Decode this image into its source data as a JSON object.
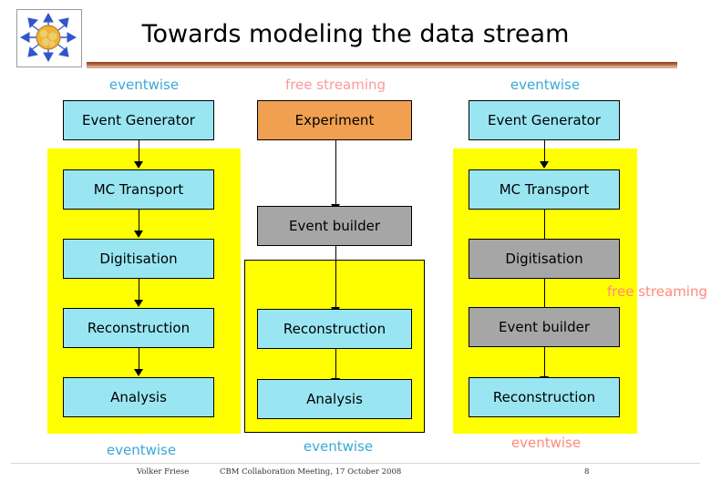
{
  "slide": {
    "title": "Towards modeling the data stream",
    "logo_name": "cbm-logo"
  },
  "column_captions": {
    "top_left": "eventwise",
    "top_mid": "free streaming",
    "top_right": "eventwise",
    "bottom_left": "eventwise",
    "bottom_mid": "eventwise",
    "bottom_right": "eventwise",
    "right_mid_label": "free streaming"
  },
  "boxes": {
    "left": [
      {
        "label": "Event Generator",
        "style": "cyan"
      },
      {
        "label": "MC Transport",
        "style": "cyan"
      },
      {
        "label": "Digitisation",
        "style": "cyan"
      },
      {
        "label": "Reconstruction",
        "style": "cyan"
      },
      {
        "label": "Analysis",
        "style": "cyan"
      }
    ],
    "middle": [
      {
        "label": "Experiment",
        "style": "orange"
      },
      {
        "label": "Event builder",
        "style": "grey"
      },
      {
        "label": "Reconstruction",
        "style": "cyan"
      },
      {
        "label": "Analysis",
        "style": "cyan"
      }
    ],
    "right": [
      {
        "label": "Event Generator",
        "style": "cyan"
      },
      {
        "label": "MC Transport",
        "style": "cyan"
      },
      {
        "label": "Digitisation",
        "style": "grey"
      },
      {
        "label": "Event builder",
        "style": "grey"
      },
      {
        "label": "Reconstruction",
        "style": "cyan"
      }
    ]
  },
  "footer": {
    "author": "Volker Friese",
    "center": "CBM Collaboration Meeting, 17 October 2008",
    "page": "8"
  },
  "colors": {
    "cyan": "#99e6f2",
    "orange": "#f0a050",
    "grey": "#a6a6a6",
    "panel": "#ffff00",
    "caption_blue": "#3aa8d8",
    "caption_pink": "#ff9a9a",
    "caption_salmon": "#ff8a7a"
  }
}
